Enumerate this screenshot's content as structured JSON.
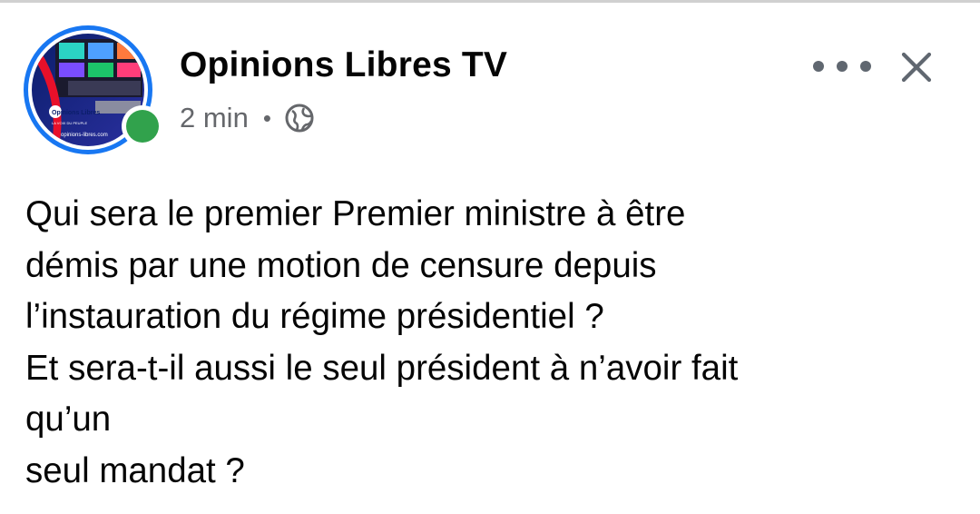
{
  "post": {
    "page_name": "Opinions Libres TV",
    "timestamp": "2 min",
    "separator": "•",
    "audience_icon": "globe-icon",
    "more_icon": "more-options-icon",
    "close_icon": "close-icon",
    "avatar": {
      "logo_text": "Opinions Libres",
      "tagline": "LA VOIX DU PEUPLE",
      "website": "opinions-libres.com"
    },
    "online_status_color": "#31a24c",
    "text_lines": [
      "Qui sera le premier Premier ministre à être",
      "démis par une motion de censure depuis",
      "l’instauration du régime présidentiel ?",
      "Et sera-t-il aussi le seul président à n’avoir fait",
      "qu’un",
      "seul mandat ?"
    ]
  },
  "colors": {
    "accent": "#1877f2",
    "secondary_text": "#65676b",
    "online": "#31a24c"
  }
}
